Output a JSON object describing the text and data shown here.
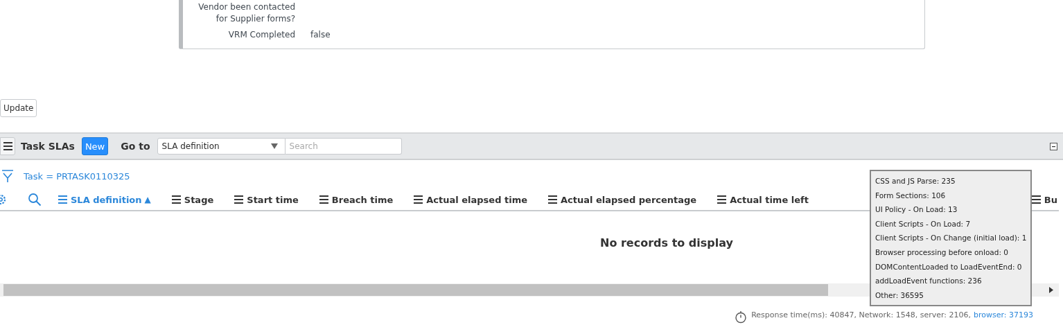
{
  "form": {
    "fields": [
      {
        "label": "Vendor been contacted for Supplier forms?"
      },
      {
        "label": "VRM Completed",
        "value": "false"
      }
    ]
  },
  "update_button": "Update",
  "related_list": {
    "title": "Task SLAs",
    "new_button": "New",
    "goto_label": "Go to",
    "goto_select": "SLA definition",
    "search": {
      "placeholder": "Search"
    },
    "filter": "Task = PRTASK0110325",
    "columns": [
      {
        "label": "SLA definition",
        "sorted": true,
        "sort_arrow": "▲"
      },
      {
        "label": "Stage",
        "sorted": false
      },
      {
        "label": "Start time",
        "sorted": false
      },
      {
        "label": "Breach time",
        "sorted": false
      },
      {
        "label": "Actual elapsed time",
        "sorted": false
      },
      {
        "label": "Actual elapsed percentage",
        "sorted": false
      },
      {
        "label": "Actual time left",
        "sorted": false
      },
      {
        "label": "Bu",
        "sorted": false
      }
    ],
    "empty_message": "No records to display"
  },
  "timing_tooltip": {
    "lines": [
      "CSS and JS Parse: 235",
      "Form Sections: 106",
      "UI Policy - On Load: 13",
      "Client Scripts - On Load: 7",
      "Client Scripts - On Change (initial load): 1",
      "Browser processing before onload: 0",
      "DOMContentLoaded to LoadEventEnd: 0",
      "addLoadEvent functions: 236",
      "Other: 36595"
    ]
  },
  "response": {
    "text": "Response time(ms): 40847, Network: 1548, server: 2106,",
    "browser_link": "browser: 37193"
  }
}
